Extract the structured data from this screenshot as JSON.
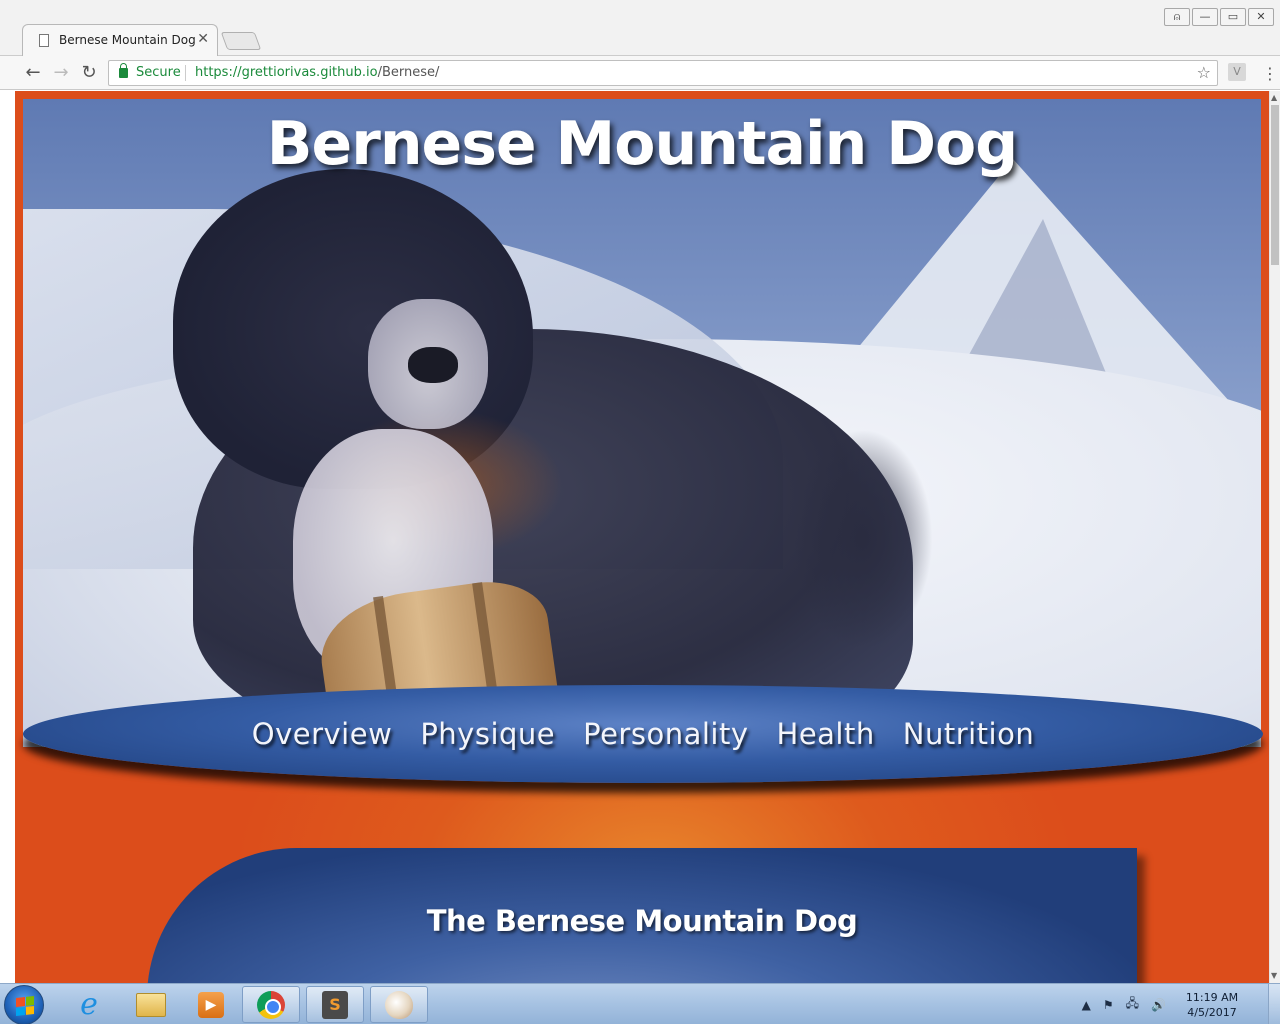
{
  "browser": {
    "tab": {
      "title": "Bernese Mountain Dog",
      "close_glyph": "✕"
    },
    "window_buttons": [
      "⍝",
      "—",
      "▭",
      "✕"
    ],
    "nav": {
      "back": "←",
      "forward": "→",
      "reload": "↻"
    },
    "omnibox": {
      "secure_label": "Secure",
      "url_host": "https://grettiorivas.github.io",
      "url_path": "/Bernese/",
      "star_glyph": "☆"
    },
    "extension_label": "V",
    "menu_glyph": "⋮"
  },
  "page": {
    "hero_title": "Bernese Mountain Dog",
    "nav_links": [
      "Overview",
      "Physique",
      "Personality",
      "Health",
      "Nutrition"
    ],
    "card_title": "The Bernese Mountain Dog",
    "colors": {
      "page_background": "#dc4d1b",
      "nav_blue": "#345ca4",
      "card_blue": "#213e7a"
    }
  },
  "taskbar": {
    "apps": [
      {
        "name": "internet-explorer",
        "glyph": "e"
      },
      {
        "name": "file-explorer",
        "glyph": ""
      },
      {
        "name": "media-player",
        "glyph": "▶"
      },
      {
        "name": "google-chrome",
        "glyph": ""
      },
      {
        "name": "sublime-text",
        "glyph": "S"
      },
      {
        "name": "paint",
        "glyph": "🎨"
      }
    ],
    "tray_icons": [
      "▲",
      "⚑",
      "🖧",
      "🔊"
    ],
    "clock": {
      "time": "11:19 AM",
      "date": "4/5/2017"
    }
  }
}
